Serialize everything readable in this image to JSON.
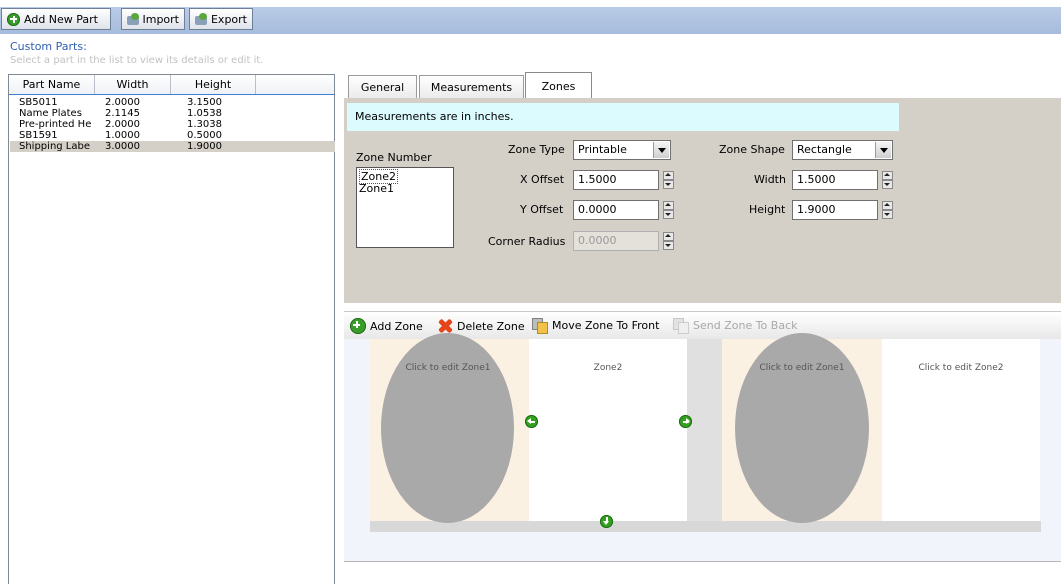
{
  "toolbar": {
    "add_new_part": "Add New Part",
    "import": "Import",
    "export": "Export"
  },
  "custom_parts": {
    "title": "Custom Parts:",
    "hint": "Select a part in the list to view its details or edit it.",
    "columns": [
      "Part Name",
      "Width",
      "Height"
    ],
    "rows": [
      {
        "name": "SB5011",
        "width": "2.0000",
        "height": "3.1500",
        "selected": false
      },
      {
        "name": "Name Plates",
        "width": "2.1145",
        "height": "1.0538",
        "selected": false
      },
      {
        "name": "Pre-printed He",
        "width": "2.0000",
        "height": "1.3038",
        "selected": false
      },
      {
        "name": "SB1591",
        "width": "1.0000",
        "height": "0.5000",
        "selected": false
      },
      {
        "name": "Shipping Labe",
        "width": "3.0000",
        "height": "1.9000",
        "selected": true
      }
    ]
  },
  "tabs": [
    {
      "label": "General",
      "active": false
    },
    {
      "label": "Measurements",
      "active": false
    },
    {
      "label": "Zones",
      "active": true
    }
  ],
  "zones": {
    "info": "Measurements are in inches.",
    "zone_number_label": "Zone Number",
    "zone_items": [
      "Zone2",
      "Zone1"
    ],
    "zone_type_label": "Zone Type",
    "zone_type_value": "Printable",
    "x_offset_label": "X Offset",
    "x_offset_value": "1.5000",
    "y_offset_label": "Y Offset",
    "y_offset_value": "0.0000",
    "corner_radius_label": "Corner Radius",
    "corner_radius_value": "0.0000",
    "zone_shape_label": "Zone Shape",
    "zone_shape_value": "Rectangle",
    "width_label": "Width",
    "width_value": "1.5000",
    "height_label": "Height",
    "height_value": "1.9000"
  },
  "zone_toolbar": {
    "add_zone": "Add Zone",
    "delete_zone": "Delete Zone",
    "move_front": "Move Zone To Front",
    "send_back": "Send Zone To Back"
  },
  "preview": {
    "label1_zone1": "Click to edit Zone1",
    "label1_zone2": "Zone2",
    "label2_zone1": "Click to edit Zone1",
    "label2_zone2": "Click to edit Zone2"
  },
  "colors": {
    "toolbar_bg": "#b0c4e2",
    "panel_bg": "#d4d0c8",
    "info_bg": "#dcfbff",
    "link_blue": "#2f5fb2",
    "selection_gray": "#d4d0c8"
  }
}
